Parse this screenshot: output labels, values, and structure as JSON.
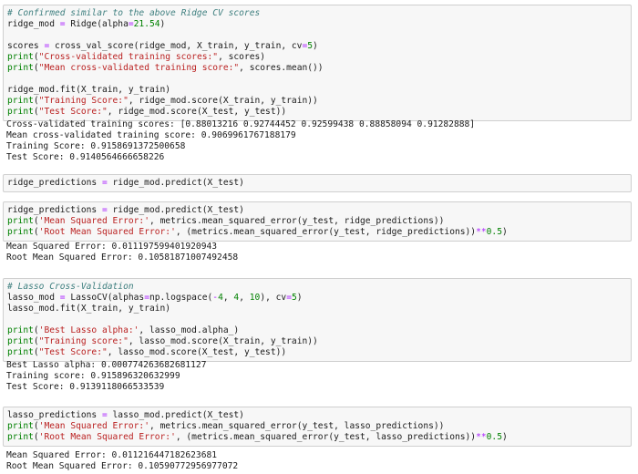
{
  "colors": {
    "comment": "#408080",
    "keyword": "#008000",
    "string": "#ba2121",
    "number": "#008000",
    "operator": "#aa22ff",
    "cell_background": "#f7f7f7",
    "cell_border": "#cfcfcf"
  },
  "cells": [
    {
      "kind": "code",
      "lines": [
        [
          {
            "t": "cm",
            "v": "# Confirmed similar to the above Ridge CV scores"
          }
        ],
        [
          {
            "t": "pl",
            "v": "ridge_mod "
          },
          {
            "t": "op",
            "v": "="
          },
          {
            "t": "pl",
            "v": " Ridge(alpha"
          },
          {
            "t": "op",
            "v": "="
          },
          {
            "t": "nm",
            "v": "21.54"
          },
          {
            "t": "pl",
            "v": ")"
          }
        ],
        [],
        [
          {
            "t": "pl",
            "v": "scores "
          },
          {
            "t": "op",
            "v": "="
          },
          {
            "t": "pl",
            "v": " cross_val_score(ridge_mod, X_train, y_train, cv"
          },
          {
            "t": "op",
            "v": "="
          },
          {
            "t": "nm",
            "v": "5"
          },
          {
            "t": "pl",
            "v": ")"
          }
        ],
        [
          {
            "t": "kw",
            "v": "print"
          },
          {
            "t": "pl",
            "v": "("
          },
          {
            "t": "st",
            "v": "\"Cross-validated training scores:\""
          },
          {
            "t": "pl",
            "v": ", scores)"
          }
        ],
        [
          {
            "t": "kw",
            "v": "print"
          },
          {
            "t": "pl",
            "v": "("
          },
          {
            "t": "st",
            "v": "\"Mean cross-validated training score:\""
          },
          {
            "t": "pl",
            "v": ", scores.mean())"
          }
        ],
        [],
        [
          {
            "t": "pl",
            "v": "ridge_mod.fit(X_train, y_train)"
          }
        ],
        [
          {
            "t": "kw",
            "v": "print"
          },
          {
            "t": "pl",
            "v": "("
          },
          {
            "t": "st",
            "v": "\"Training Score:\""
          },
          {
            "t": "pl",
            "v": ", ridge_mod.score(X_train, y_train))"
          }
        ],
        [
          {
            "t": "kw",
            "v": "print"
          },
          {
            "t": "pl",
            "v": "("
          },
          {
            "t": "st",
            "v": "\"Test Score:\""
          },
          {
            "t": "pl",
            "v": ", ridge_mod.score(X_test, y_test))"
          }
        ]
      ]
    },
    {
      "kind": "output",
      "lines": [
        "Cross-validated training scores: [0.88013216 0.92744452 0.92599438 0.88858094 0.91282888]",
        "Mean cross-validated training score: 0.9069961767188179",
        "Training Score: 0.9158691372500658",
        "Test Score: 0.9140564666658226"
      ]
    },
    {
      "kind": "code",
      "lines": [
        [
          {
            "t": "pl",
            "v": "ridge_predictions "
          },
          {
            "t": "op",
            "v": "="
          },
          {
            "t": "pl",
            "v": " ridge_mod.predict(X_test)"
          }
        ]
      ]
    },
    {
      "kind": "code",
      "lines": [
        [
          {
            "t": "pl",
            "v": "ridge_predictions "
          },
          {
            "t": "op",
            "v": "="
          },
          {
            "t": "pl",
            "v": " ridge_mod.predict(X_test)"
          }
        ],
        [
          {
            "t": "kw",
            "v": "print"
          },
          {
            "t": "pl",
            "v": "("
          },
          {
            "t": "st",
            "v": "'Mean Squared Error:'"
          },
          {
            "t": "pl",
            "v": ", metrics.mean_squared_error(y_test, ridge_predictions))"
          }
        ],
        [
          {
            "t": "kw",
            "v": "print"
          },
          {
            "t": "pl",
            "v": "("
          },
          {
            "t": "st",
            "v": "'Root Mean Squared Error:'"
          },
          {
            "t": "pl",
            "v": ", (metrics.mean_squared_error(y_test, ridge_predictions))"
          },
          {
            "t": "op",
            "v": "**"
          },
          {
            "t": "nm",
            "v": "0.5"
          },
          {
            "t": "pl",
            "v": ")"
          }
        ]
      ]
    },
    {
      "kind": "output",
      "lines": [
        "Mean Squared Error: 0.011197599401920943",
        "Root Mean Squared Error: 0.10581871007492458"
      ]
    },
    {
      "kind": "code",
      "lines": [
        [
          {
            "t": "cm",
            "v": "# Lasso Cross-Validation"
          }
        ],
        [
          {
            "t": "pl",
            "v": "lasso_mod "
          },
          {
            "t": "op",
            "v": "="
          },
          {
            "t": "pl",
            "v": " LassoCV(alphas"
          },
          {
            "t": "op",
            "v": "="
          },
          {
            "t": "pl",
            "v": "np.logspace("
          },
          {
            "t": "op",
            "v": "-"
          },
          {
            "t": "nm",
            "v": "4"
          },
          {
            "t": "pl",
            "v": ", "
          },
          {
            "t": "nm",
            "v": "4"
          },
          {
            "t": "pl",
            "v": ", "
          },
          {
            "t": "nm",
            "v": "10"
          },
          {
            "t": "pl",
            "v": "), cv"
          },
          {
            "t": "op",
            "v": "="
          },
          {
            "t": "nm",
            "v": "5"
          },
          {
            "t": "pl",
            "v": ")"
          }
        ],
        [
          {
            "t": "pl",
            "v": "lasso_mod.fit(X_train, y_train)"
          }
        ],
        [],
        [
          {
            "t": "kw",
            "v": "print"
          },
          {
            "t": "pl",
            "v": "("
          },
          {
            "t": "st",
            "v": "'Best Lasso alpha:'"
          },
          {
            "t": "pl",
            "v": ", lasso_mod.alpha_)"
          }
        ],
        [
          {
            "t": "kw",
            "v": "print"
          },
          {
            "t": "pl",
            "v": "("
          },
          {
            "t": "st",
            "v": "\"Training score:\""
          },
          {
            "t": "pl",
            "v": ", lasso_mod.score(X_train, y_train))"
          }
        ],
        [
          {
            "t": "kw",
            "v": "print"
          },
          {
            "t": "pl",
            "v": "("
          },
          {
            "t": "st",
            "v": "\"Test Score:\""
          },
          {
            "t": "pl",
            "v": ", lasso_mod.score(X_test, y_test))"
          }
        ]
      ]
    },
    {
      "kind": "output",
      "lines": [
        "Best Lasso alpha: 0.000774263682681127",
        "Training score: 0.915896320632999",
        "Test Score: 0.9139118066533539"
      ]
    },
    {
      "kind": "code",
      "lines": [
        [
          {
            "t": "pl",
            "v": "lasso_predictions "
          },
          {
            "t": "op",
            "v": "="
          },
          {
            "t": "pl",
            "v": " lasso_mod.predict(X_test)"
          }
        ],
        [
          {
            "t": "kw",
            "v": "print"
          },
          {
            "t": "pl",
            "v": "("
          },
          {
            "t": "st",
            "v": "'Mean Squared Error:'"
          },
          {
            "t": "pl",
            "v": ", metrics.mean_squared_error(y_test, lasso_predictions))"
          }
        ],
        [
          {
            "t": "kw",
            "v": "print"
          },
          {
            "t": "pl",
            "v": "("
          },
          {
            "t": "st",
            "v": "'Root Mean Squared Error:'"
          },
          {
            "t": "pl",
            "v": ", (metrics.mean_squared_error(y_test, lasso_predictions))"
          },
          {
            "t": "op",
            "v": "**"
          },
          {
            "t": "nm",
            "v": "0.5"
          },
          {
            "t": "pl",
            "v": ")"
          }
        ]
      ]
    },
    {
      "kind": "output",
      "lines": [
        "Mean Squared Error: 0.011216447182623681",
        "Root Mean Squared Error: 0.10590772956977072"
      ]
    }
  ]
}
